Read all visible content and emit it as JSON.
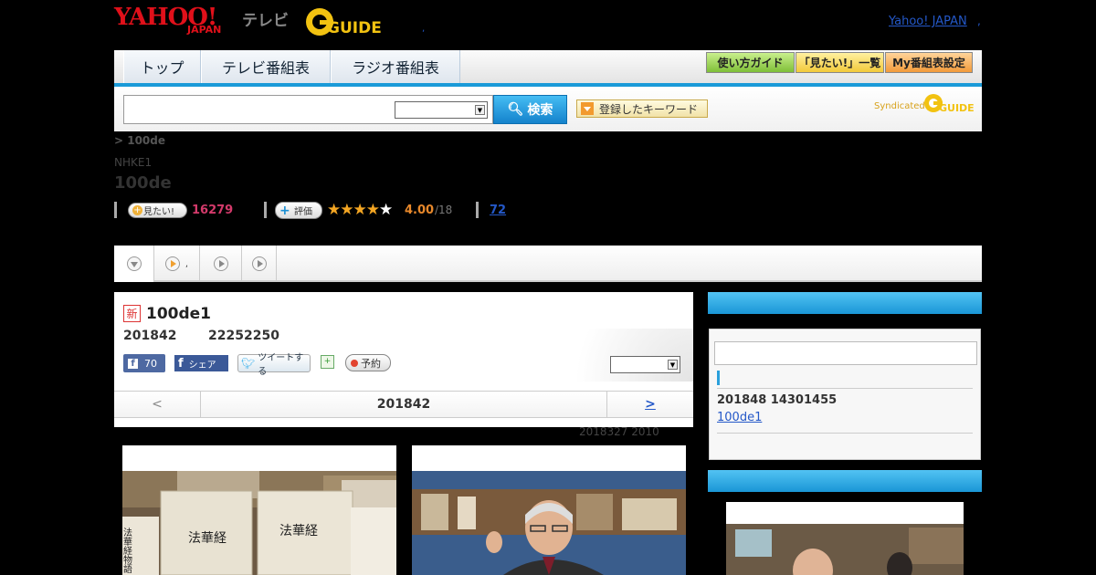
{
  "header": {
    "logo_yahoo": "YAHOO!",
    "logo_japan": "JAPAN",
    "logo_tv": "テレビ",
    "logo_gguide": "GUIDE",
    "dot": ",",
    "yahoo_link": "Yahoo! JAPAN",
    "yahoo_link_dot": ","
  },
  "nav": {
    "tabs": [
      {
        "label": "トップ"
      },
      {
        "label": "テレビ番組表"
      },
      {
        "label": "ラジオ番組表"
      }
    ],
    "buttons": [
      {
        "label": "使い方ガイド",
        "color": "#8fd04a"
      },
      {
        "label": "「見たい!」一覧",
        "color": "#f7d34a"
      },
      {
        "label": "My番組表設定",
        "color": "#f7a44a"
      }
    ]
  },
  "search": {
    "button_label": "検索",
    "keyword_button": "登録したキーワード",
    "syndicated": "Syndicated",
    "syndicated_logo": "GUIDE"
  },
  "program": {
    "breadcrumb": "> 100de",
    "channel": "NHKE1",
    "title": "100de",
    "want_label": "見たい!",
    "want_count": "16279",
    "rate_label": "評価",
    "stars_filled": 4,
    "stars_total": 5,
    "rating": "4.00",
    "rating_den": "/18",
    "reviews": "72"
  },
  "subtabs": {
    "second_label": ","
  },
  "episode": {
    "new_badge": "新",
    "title": "100de1",
    "date": "201842",
    "time": "22252250",
    "fb_like_count": "70",
    "fb_like_letter": "f",
    "fb_share_label": "シェア",
    "fb_share_letter": "f",
    "tweet_label": "ツイートする",
    "reserve_label": "予約",
    "pager_prev": "<",
    "pager_date": "201842",
    "pager_next": ">",
    "broadcast_note": "2018327  2010"
  },
  "sidebar": {
    "latest_date": "201848  14301455",
    "latest_link": "100de1"
  },
  "images": {
    "book_title_left": "法華経",
    "book_title_right": "法華経",
    "book_spine": "法華経物語"
  },
  "colors": {
    "accent_blue": "#1a9ad8",
    "link": "#2458c8",
    "want_count": "#d43a6b",
    "rating": "#e9892b",
    "logo_red": "#e0101a"
  }
}
